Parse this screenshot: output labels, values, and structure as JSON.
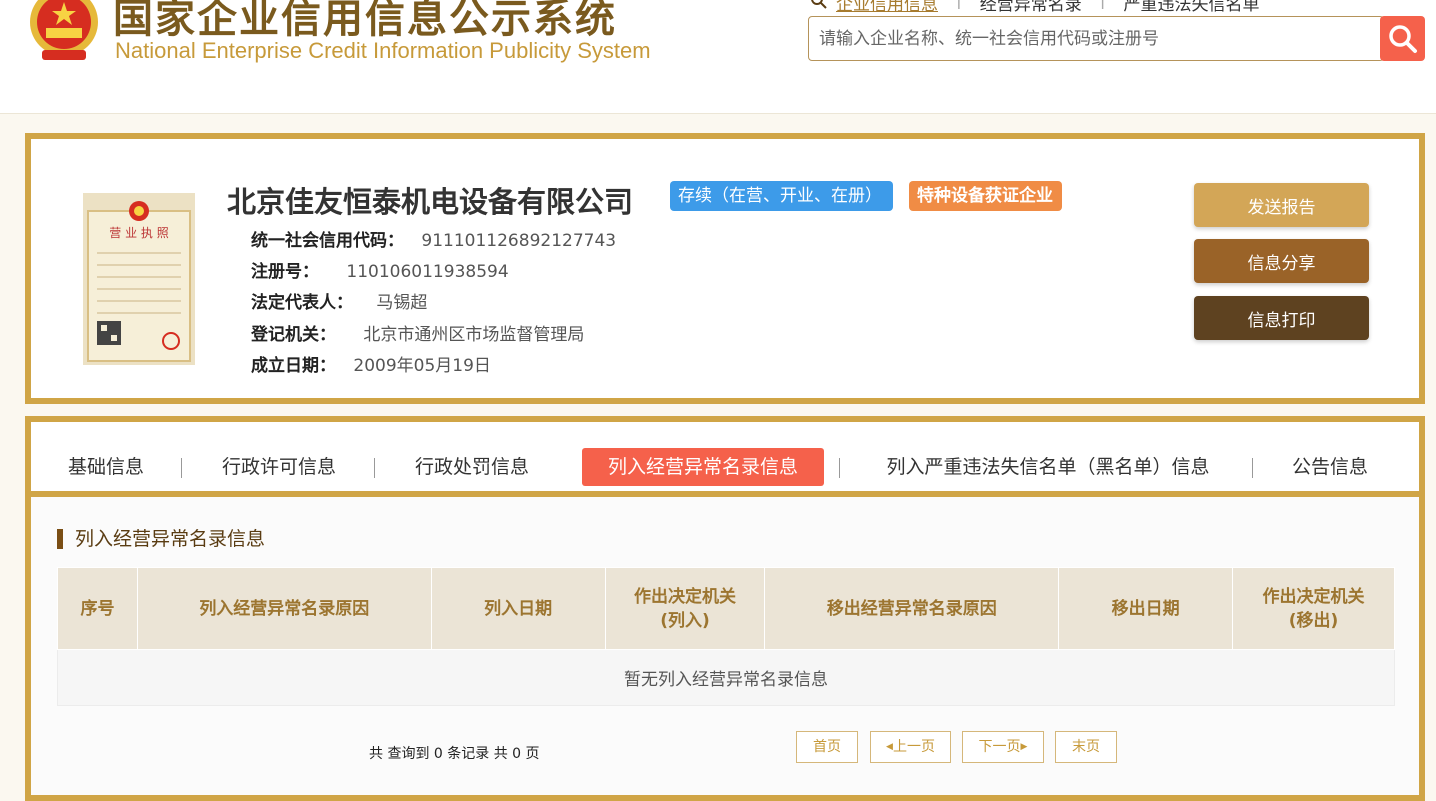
{
  "header": {
    "title": "国家企业信用信息公示系统",
    "subtitle": "National Enterprise Credit Information Publicity System",
    "links": [
      "企业信用信息",
      "经营异常名录",
      "严重违法失信名单"
    ],
    "search_placeholder": "请输入企业名称、统一社会信用代码或注册号"
  },
  "company": {
    "name": "北京佳友恒泰机电设备有限公司",
    "status_badge": "存续（在营、开业、在册）",
    "special_badge": "特种设备获证企业",
    "license_title": "营 业 执 照",
    "fields": [
      {
        "label": "统一社会信用代码：",
        "value": "911101126892127743"
      },
      {
        "label": "注册号：",
        "value": "110106011938594"
      },
      {
        "label": "法定代表人：",
        "value": "马锡超"
      },
      {
        "label": "登记机关：",
        "value": "北京市通州区市场监督管理局"
      },
      {
        "label": "成立日期：",
        "value": "2009年05月19日"
      }
    ],
    "actions": {
      "send": "发送报告",
      "share": "信息分享",
      "print": "信息打印"
    }
  },
  "tabs": [
    "基础信息",
    "行政许可信息",
    "行政处罚信息",
    "列入经营异常名录信息",
    "列入严重违法失信名单（黑名单）信息",
    "公告信息"
  ],
  "section": {
    "title": "列入经营异常名录信息",
    "columns": [
      "序号",
      "列入经营异常名录原因",
      "列入日期",
      "作出决定机关\n(列入)",
      "移出经营异常名录原因",
      "移出日期",
      "作出决定机关\n(移出)"
    ],
    "empty_text": "暂无列入经营异常名录信息",
    "summary": "共 查询到 0 条记录 共 0 页",
    "pagination": {
      "first": "首页",
      "prev": "上一页",
      "next": "下一页",
      "last": "末页"
    }
  },
  "colors": {
    "gold": "#d0a546",
    "red": "#f5614b",
    "blue": "#3d9be9",
    "orange": "#f08c45"
  }
}
